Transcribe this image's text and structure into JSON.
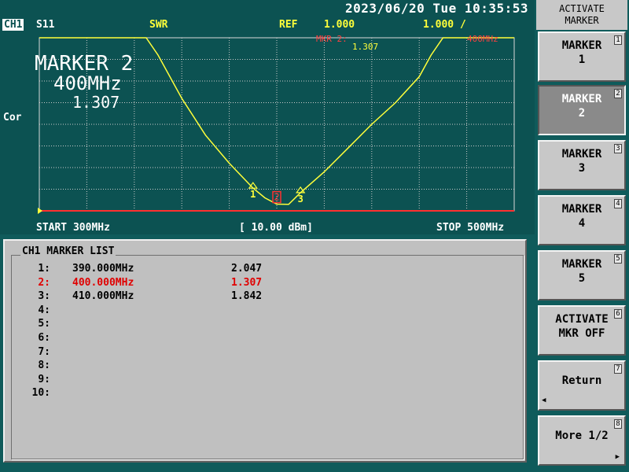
{
  "status": {
    "datetime": "2023/06/20 Tue 10:35:53"
  },
  "header": {
    "channel": "CH1",
    "param": "S11",
    "format": "SWR",
    "ref_label": "REF",
    "ref_value": "1.000",
    "scale": "1.000 /"
  },
  "plot": {
    "corr_label": "Cor",
    "marker_readout": {
      "title": "MARKER 2",
      "freq": "400MHz",
      "value": "1.307"
    },
    "marker_annotation": {
      "label": "MKR 2:",
      "value": "1.307",
      "freq": "400MHz"
    },
    "start": "START 300MHz",
    "power": "[ 10.00 dBm]",
    "stop": "STOP 500MHz",
    "colors": {
      "trace": "#ffff3a",
      "grid": "#cccccc",
      "active_marker": "#ff3030",
      "ref_line": "#ff3030",
      "background": "#0c5252"
    },
    "trace_swr": [
      {
        "f": 300,
        "swr": 9.0
      },
      {
        "f": 340,
        "swr": 9.0
      },
      {
        "f": 345,
        "swr": 9.0
      },
      {
        "f": 350,
        "swr": 8.2
      },
      {
        "f": 360,
        "swr": 6.2
      },
      {
        "f": 370,
        "swr": 4.5
      },
      {
        "f": 380,
        "swr": 3.2
      },
      {
        "f": 390,
        "swr": 2.05
      },
      {
        "f": 395,
        "swr": 1.6
      },
      {
        "f": 400,
        "swr": 1.31
      },
      {
        "f": 405,
        "swr": 1.3
      },
      {
        "f": 410,
        "swr": 1.84
      },
      {
        "f": 420,
        "swr": 2.8
      },
      {
        "f": 430,
        "swr": 3.9
      },
      {
        "f": 440,
        "swr": 5.0
      },
      {
        "f": 450,
        "swr": 6.0
      },
      {
        "f": 460,
        "swr": 7.2
      },
      {
        "f": 465,
        "swr": 8.2
      },
      {
        "f": 470,
        "swr": 9.0
      },
      {
        "f": 500,
        "swr": 9.0
      }
    ],
    "markers": [
      {
        "id": "1",
        "f": 390,
        "swr": 2.047,
        "active": false
      },
      {
        "id": "2",
        "f": 400,
        "swr": 1.307,
        "active": true
      },
      {
        "id": "3",
        "f": 410,
        "swr": 1.842,
        "active": false
      }
    ]
  },
  "marker_list": {
    "title": "CH1 MARKER LIST",
    "rows": [
      {
        "n": "1:",
        "freq": "390.000MHz",
        "value": "2.047",
        "active": false
      },
      {
        "n": "2:",
        "freq": "400.000MHz",
        "value": "1.307",
        "active": true
      },
      {
        "n": "3:",
        "freq": "410.000MHz",
        "value": "1.842",
        "active": false
      },
      {
        "n": "4:",
        "freq": "",
        "value": "",
        "active": false
      },
      {
        "n": "5:",
        "freq": "",
        "value": "",
        "active": false
      },
      {
        "n": "6:",
        "freq": "",
        "value": "",
        "active": false
      },
      {
        "n": "7:",
        "freq": "",
        "value": "",
        "active": false
      },
      {
        "n": "8:",
        "freq": "",
        "value": "",
        "active": false
      },
      {
        "n": "9:",
        "freq": "",
        "value": "",
        "active": false
      },
      {
        "n": "10:",
        "freq": "",
        "value": "",
        "active": false
      }
    ]
  },
  "softkeys": {
    "title_line1": "ACTIVATE",
    "title_line2": "MARKER",
    "keys": [
      {
        "l1": "MARKER",
        "l2": "1",
        "num": "1",
        "selected": false
      },
      {
        "l1": "MARKER",
        "l2": "2",
        "num": "2",
        "selected": true
      },
      {
        "l1": "MARKER",
        "l2": "3",
        "num": "3",
        "selected": false
      },
      {
        "l1": "MARKER",
        "l2": "4",
        "num": "4",
        "selected": false
      },
      {
        "l1": "MARKER",
        "l2": "5",
        "num": "5",
        "selected": false
      },
      {
        "l1": "ACTIVATE",
        "l2": "MKR OFF",
        "num": "6",
        "selected": false
      },
      {
        "l1": "Return",
        "l2": "",
        "num": "7",
        "selected": false,
        "arrow": "◀"
      },
      {
        "l1": "More 1/2",
        "l2": "",
        "num": "8",
        "selected": false,
        "arrow": "▶"
      }
    ]
  }
}
